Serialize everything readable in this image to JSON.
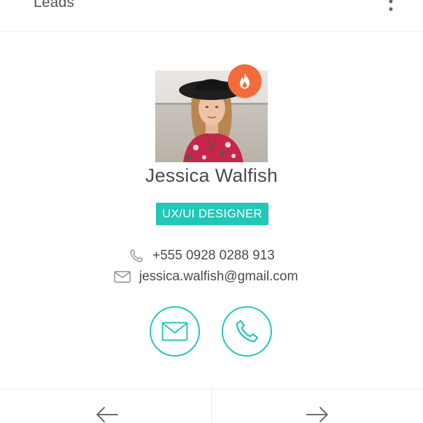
{
  "header": {
    "title": "Leads"
  },
  "profile": {
    "name": "Jessica Walfish",
    "role": "UX/UI DESIGNER",
    "phone": "+555 0928 0288 913",
    "email": "jessica.walfish@gmail.com",
    "hot_icon": "flame-icon"
  },
  "actions": {
    "email_icon": "envelope-icon",
    "call_icon": "phone-icon"
  },
  "nav": {
    "prev_icon": "arrow-left-icon",
    "next_icon": "arrow-right-icon"
  },
  "colors": {
    "accent": "#22c7b8",
    "hot": "#f26b3a",
    "text": "#4a4a4a",
    "divider": "#ededed"
  }
}
